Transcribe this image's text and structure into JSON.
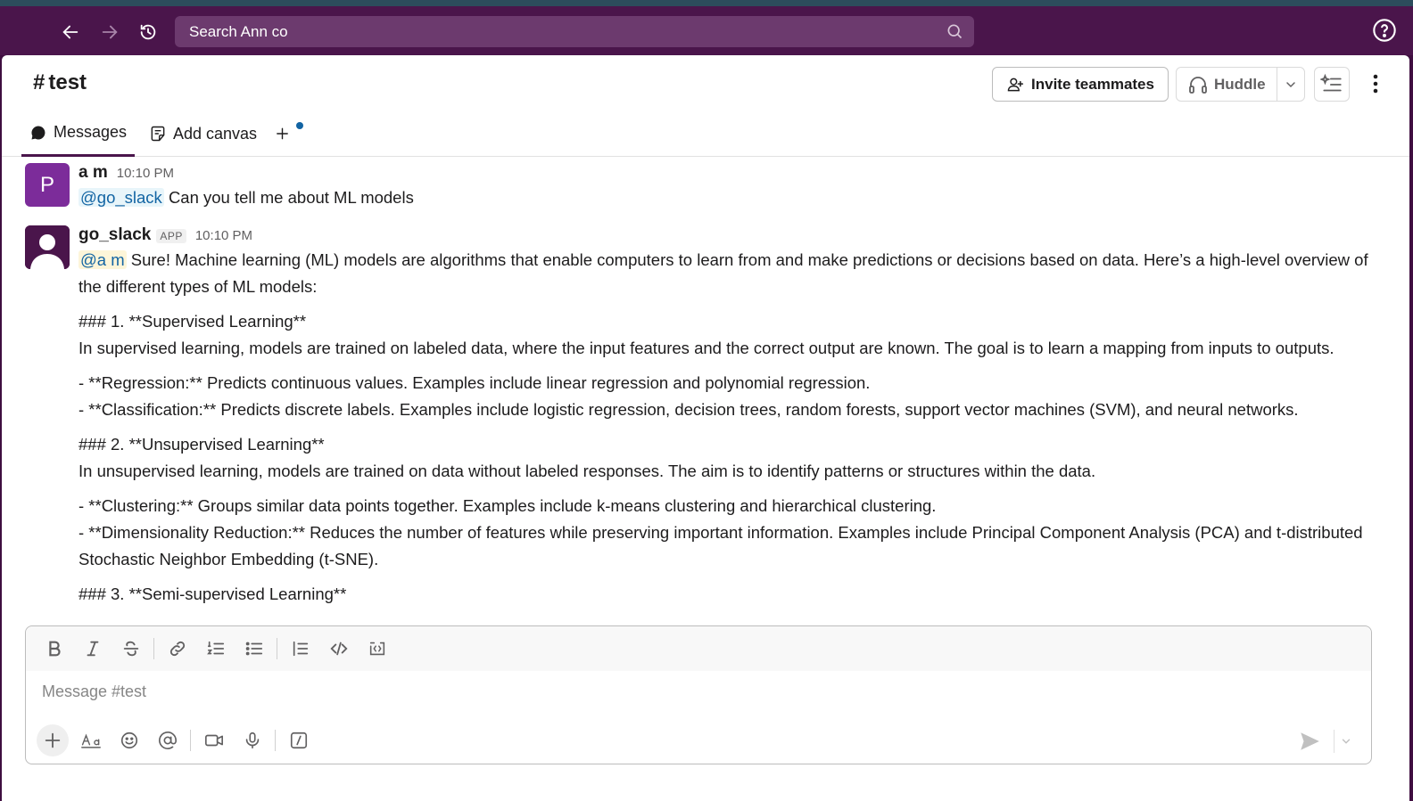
{
  "search": {
    "placeholder": "Search Ann co"
  },
  "channel": {
    "hash": "#",
    "name": "test"
  },
  "header": {
    "invite_label": "Invite teammates",
    "huddle_label": "Huddle"
  },
  "tabs": [
    {
      "label": "Messages"
    },
    {
      "label": "Add canvas"
    }
  ],
  "messages": [
    {
      "avatar_letter": "P",
      "sender": "a m",
      "time": "10:10 PM",
      "mention": "@go_slack",
      "text": "Can you tell me about ML models"
    },
    {
      "sender": "go_slack",
      "badge": "APP",
      "time": "10:10 PM",
      "mention": "@a m",
      "intro": "Sure! Machine learning (ML) models are algorithms that enable computers to learn from and make predictions or decisions based on data. Here’s a high-level overview of the different types of ML models:",
      "h1": "### 1. **Supervised Learning**",
      "p1": "In supervised learning, models are trained on labeled data, where the input features and the correct output are known. The goal is to learn a mapping from inputs to outputs.",
      "b1": "- **Regression:** Predicts continuous values. Examples include linear regression and polynomial regression.",
      "b2": "- **Classification:** Predicts discrete labels. Examples include logistic regression, decision trees, random forests, support vector machines (SVM), and neural networks.",
      "h2": "### 2. **Unsupervised Learning**",
      "p2": "In unsupervised learning, models are trained on data without labeled responses. The aim is to identify patterns or structures within the data.",
      "b3": "- **Clustering:** Groups similar data points together. Examples include k-means clustering and hierarchical clustering.",
      "b4": "- **Dimensionality Reduction:** Reduces the number of features while preserving important information. Examples include Principal Component Analysis (PCA) and t-distributed Stochastic Neighbor Embedding (t-SNE).",
      "h3": "### 3. **Semi-supervised Learning**"
    }
  ],
  "composer": {
    "placeholder": "Message #test"
  }
}
